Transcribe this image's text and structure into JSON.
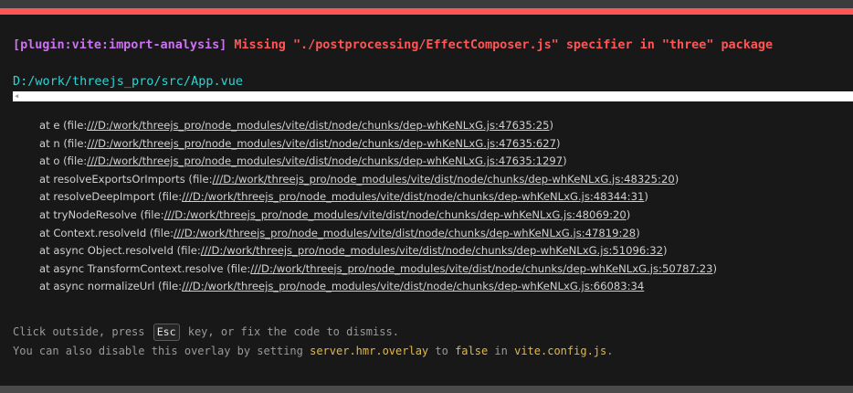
{
  "error": {
    "plugin": "[plugin:vite:import-analysis]",
    "message": "Missing \"./postprocessing/EffectComposer.js\" specifier in \"three\" package",
    "file": "D:/work/threejs_pro/src/App.vue"
  },
  "frame": {
    "scroll_left_icon": "caret-left-icon"
  },
  "stack": [
    {
      "prefix": "at e (file:",
      "link": "///D:/work/threejs_pro/node_modules/vite/dist/node/chunks/dep-whKeNLxG.js:47635:25",
      "suffix": ")"
    },
    {
      "prefix": "at n (file:",
      "link": "///D:/work/threejs_pro/node_modules/vite/dist/node/chunks/dep-whKeNLxG.js:47635:627",
      "suffix": ")"
    },
    {
      "prefix": "at o (file:",
      "link": "///D:/work/threejs_pro/node_modules/vite/dist/node/chunks/dep-whKeNLxG.js:47635:1297",
      "suffix": ")"
    },
    {
      "prefix": "at resolveExportsOrImports (file:",
      "link": "///D:/work/threejs_pro/node_modules/vite/dist/node/chunks/dep-whKeNLxG.js:48325:20",
      "suffix": ")"
    },
    {
      "prefix": "at resolveDeepImport (file:",
      "link": "///D:/work/threejs_pro/node_modules/vite/dist/node/chunks/dep-whKeNLxG.js:48344:31",
      "suffix": ")"
    },
    {
      "prefix": "at tryNodeResolve (file:",
      "link": "///D:/work/threejs_pro/node_modules/vite/dist/node/chunks/dep-whKeNLxG.js:48069:20",
      "suffix": ")"
    },
    {
      "prefix": "at Context.resolveId (file:",
      "link": "///D:/work/threejs_pro/node_modules/vite/dist/node/chunks/dep-whKeNLxG.js:47819:28",
      "suffix": ")"
    },
    {
      "prefix": "at async Object.resolveId (file:",
      "link": "///D:/work/threejs_pro/node_modules/vite/dist/node/chunks/dep-whKeNLxG.js:51096:32",
      "suffix": ")"
    },
    {
      "prefix": "at async TransformContext.resolve (file:",
      "link": "///D:/work/threejs_pro/node_modules/vite/dist/node/chunks/dep-whKeNLxG.js:50787:23",
      "suffix": ")"
    },
    {
      "prefix": "at async normalizeUrl (file:",
      "link": "///D:/work/threejs_pro/node_modules/vite/dist/node/chunks/dep-whKeNLxG.js:66083:34",
      "suffix": ""
    }
  ],
  "tips": {
    "line1_before": "Click outside, press ",
    "key": "Esc",
    "line1_after": " key, or fix the code to dismiss.",
    "line2_a": "You can also disable this overlay by setting ",
    "line2_code1": "server.hmr.overlay",
    "line2_b": " to ",
    "line2_code2": "false",
    "line2_c": " in ",
    "line2_code3": "vite.config.js",
    "line2_d": "."
  },
  "colors": {
    "accent_red": "#ff5555",
    "plugin_purple": "#cb72f0",
    "file_cyan": "#2dd4d4",
    "code_yellow": "#e0b84c",
    "background": "#181818"
  }
}
